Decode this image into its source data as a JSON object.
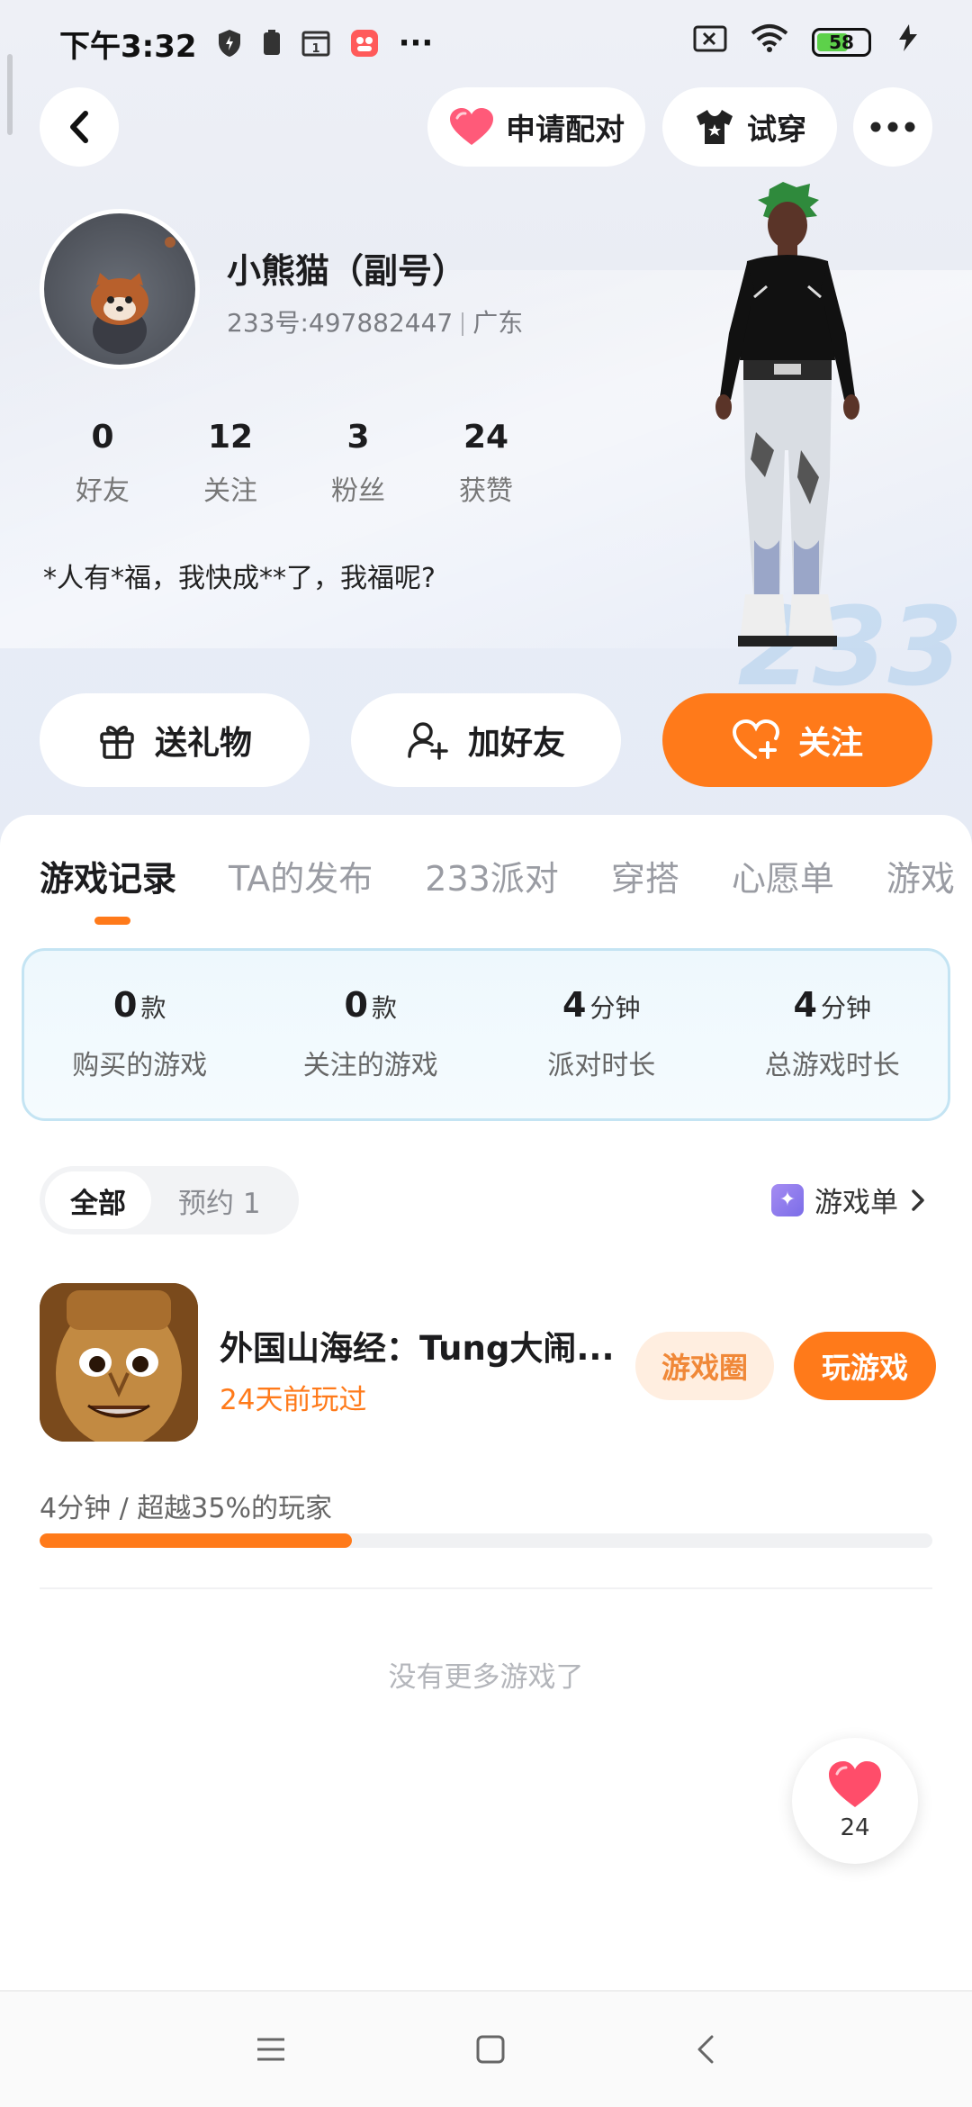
{
  "status_bar": {
    "time": "下午3:32",
    "battery": "58",
    "more": "···"
  },
  "header": {
    "pair_label": "申请配对",
    "tryon_label": "试穿"
  },
  "profile": {
    "name": "小熊猫（副号）",
    "id": "233号:497882447",
    "region": "广东",
    "bio": "*人有*福，我快成**了，我福呢?",
    "stats": [
      {
        "num": "0",
        "label": "好友"
      },
      {
        "num": "12",
        "label": "关注"
      },
      {
        "num": "3",
        "label": "粉丝"
      },
      {
        "num": "24",
        "label": "获赞"
      }
    ]
  },
  "actions": {
    "gift": "送礼物",
    "add_friend": "加好友",
    "follow": "关注"
  },
  "tabs": [
    "游戏记录",
    "TA的发布",
    "233派对",
    "穿搭",
    "心愿单",
    "游戏"
  ],
  "summary": [
    {
      "value": "0",
      "unit": "款",
      "label": "购买的游戏"
    },
    {
      "value": "0",
      "unit": "款",
      "label": "关注的游戏"
    },
    {
      "value": "4",
      "unit": "分钟",
      "label": "派对时长"
    },
    {
      "value": "4",
      "unit": "分钟",
      "label": "总游戏时长"
    }
  ],
  "filter": {
    "all": "全部",
    "reserve": "预约 1"
  },
  "game_list_link": "游戏单",
  "game": {
    "title": "外国山海经：Tung大闹...",
    "last_played": "24天前玩过",
    "circle_btn": "游戏圈",
    "play_btn": "玩游戏",
    "progress_text": "4分钟 / 超越35%的玩家",
    "progress_percent": 35
  },
  "no_more": "没有更多游戏了",
  "like_count": "24",
  "colors": {
    "accent": "#ff7a1a",
    "heart": "#ff4d6a"
  }
}
